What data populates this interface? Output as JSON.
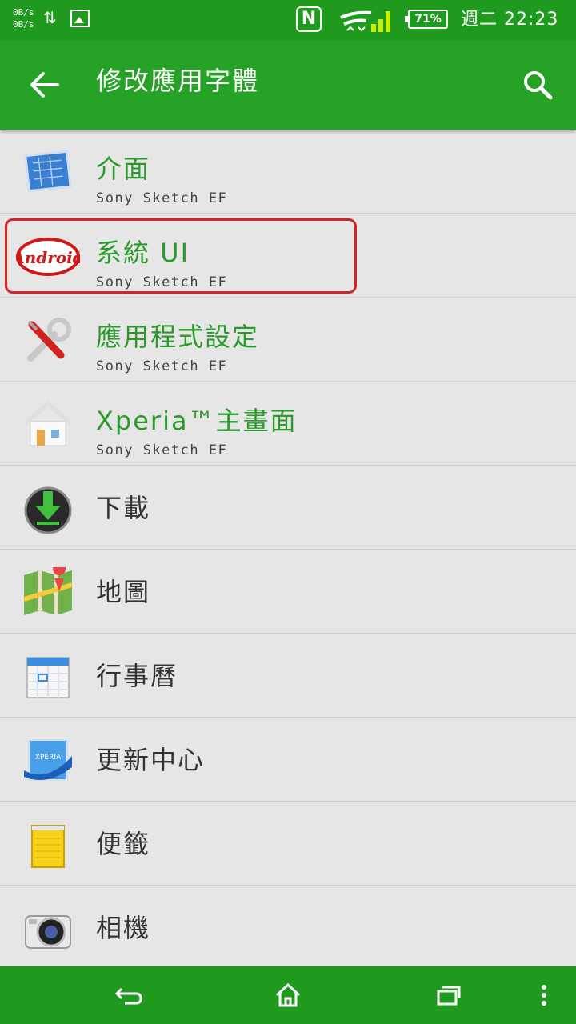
{
  "status_bar": {
    "net_up": "0B/s",
    "net_down": "0B/s",
    "battery": "71%",
    "day": "週二",
    "time": "22:23"
  },
  "header": {
    "title": "修改應用字體"
  },
  "apps": [
    {
      "name": "介面",
      "font": "Sony Sketch EF",
      "icon": "interface-blueprint-icon"
    },
    {
      "name": "系統 UI",
      "font": "Sony Sketch EF",
      "icon": "android-logo-icon"
    },
    {
      "name": "應用程式設定",
      "font": "Sony Sketch EF",
      "icon": "settings-tools-icon"
    },
    {
      "name": "Xperia™主畫面",
      "font": "Sony Sketch EF",
      "icon": "home-icon"
    },
    {
      "name": "下載",
      "icon": "download-icon"
    },
    {
      "name": "地圖",
      "icon": "maps-icon"
    },
    {
      "name": "行事曆",
      "icon": "calendar-icon"
    },
    {
      "name": "更新中心",
      "icon": "update-center-icon"
    },
    {
      "name": "便籤",
      "icon": "notes-icon"
    },
    {
      "name": "相機",
      "icon": "camera-icon"
    }
  ],
  "colors": {
    "accent": "#26a226",
    "status_bar": "#1f9a1f",
    "highlight": "#e02020",
    "label_green": "#2a9a2a"
  }
}
